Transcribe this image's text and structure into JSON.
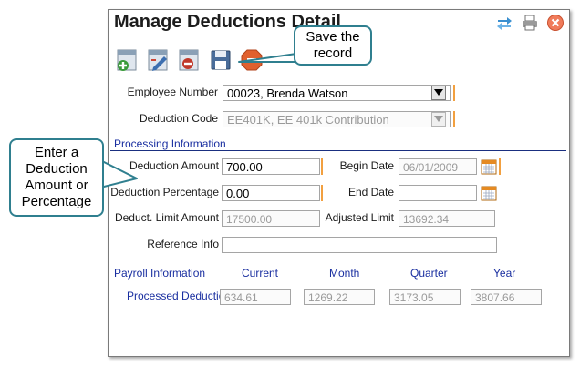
{
  "window": {
    "title": "Manage Deductions Detail",
    "title_icons": [
      "transfer-icon",
      "print-icon",
      "close-icon"
    ]
  },
  "toolbar": {
    "buttons": [
      {
        "name": "add-record-button",
        "icon": "add-icon"
      },
      {
        "name": "edit-record-button",
        "icon": "edit-icon"
      },
      {
        "name": "delete-record-button",
        "icon": "delete-icon"
      },
      {
        "name": "save-record-button",
        "icon": "save-icon"
      },
      {
        "name": "stop-button",
        "icon": "stop-icon"
      }
    ]
  },
  "form": {
    "employee_number_label": "Employee Number",
    "employee_number_value": "00023, Brenda Watson",
    "deduction_code_label": "Deduction Code",
    "deduction_code_value": "EE401K, EE 401k Contribution"
  },
  "processing": {
    "section_title": "Processing Information",
    "deduction_amount_label": "Deduction Amount",
    "deduction_amount_value": "700.00",
    "begin_date_label": "Begin Date",
    "begin_date_value": "06/01/2009",
    "deduction_percentage_label": "Deduction Percentage",
    "deduction_percentage_value": "0.00",
    "end_date_label": "End Date",
    "end_date_value": "",
    "deduct_limit_label": "Deduct. Limit Amount",
    "deduct_limit_value": "17500.00",
    "adjusted_limit_label": "Adjusted Limit",
    "adjusted_limit_value": "13692.34",
    "reference_label": "Reference Info",
    "reference_value": ""
  },
  "payroll": {
    "section_title": "Payroll Information",
    "columns": [
      "Current",
      "Month",
      "Quarter",
      "Year"
    ],
    "row_label": "Processed Deductions",
    "values": [
      "634.61",
      "1269.22",
      "3173.05",
      "3807.66"
    ]
  },
  "callouts": {
    "save": "Save the record",
    "deduction": "Enter a Deduction Amount or Percentage"
  },
  "colors": {
    "accent_blue": "#1a2fa0",
    "required_marker": "#f2a040",
    "callout_border": "#2f7f8f"
  }
}
